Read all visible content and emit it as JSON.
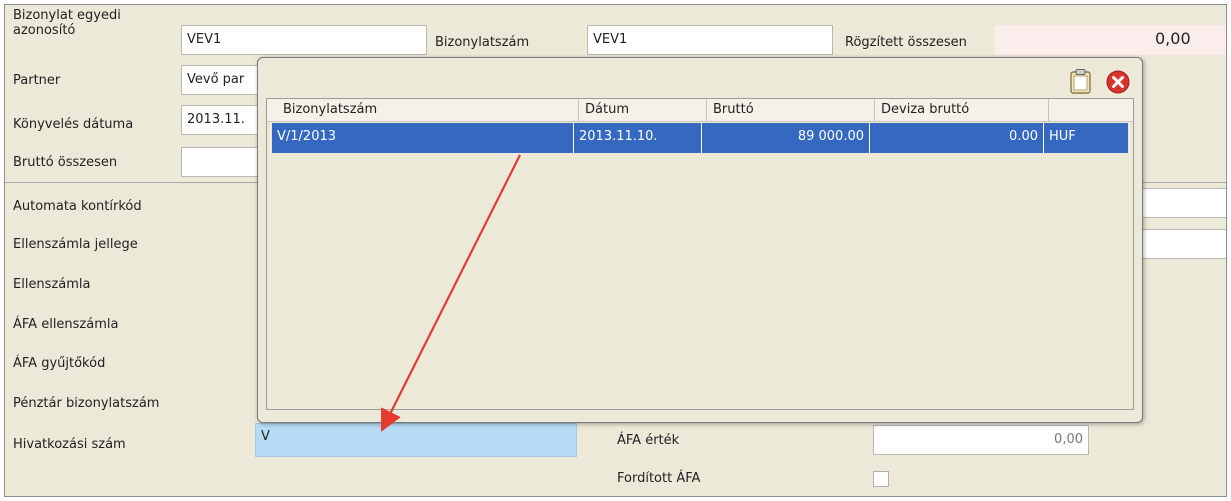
{
  "header": {
    "doc_id_label": "Bizonylat egyedi azonosító",
    "doc_id_value": "VEV1",
    "doc_number_label": "Bizonylatszám",
    "doc_number_value": "VEV1",
    "recorded_total_label": "Rögzített összesen",
    "recorded_total_value": "0,00",
    "partner_label": "Partner",
    "partner_value": "Vevő par",
    "posting_date_label": "Könyvelés dátuma",
    "posting_date_value": "2013.11.",
    "gross_total_label": "Bruttó összesen",
    "gross_total_value": ""
  },
  "form": {
    "auto_code_label": "Automata kontírkód",
    "counter_account_type_label": "Ellenszámla jellege",
    "counter_account_label": "Ellenszámla",
    "vat_counter_account_label": "ÁFA ellenszámla",
    "vat_collect_code_label": "ÁFA gyűjtőkód",
    "cash_doc_number_label": "Pénztár bizonylatszám",
    "reference_number_label": "Hivatkozási szám",
    "reference_number_value": "V",
    "vat_value_label": "ÁFA érték",
    "vat_value": "0,00",
    "reverse_vat_label": "Fordított ÁFA",
    "reverse_vat_checked": false
  },
  "popup": {
    "columns": [
      "Bizonylatszám",
      "Dátum",
      "Bruttó",
      "Deviza bruttó"
    ],
    "rows": [
      {
        "doc_number": "V/1/2013",
        "date": "2013.11.10.",
        "gross": "89 000.00",
        "fx_gross": "0.00",
        "currency": "HUF"
      }
    ],
    "icons": {
      "clipboard": "clipboard-icon",
      "close": "close-icon"
    }
  },
  "colors": {
    "selection": "#3569c1",
    "reference_field": "#b6dcf5",
    "arrow": "#e53a30",
    "recorded_total_bg": "#fdeeee"
  }
}
